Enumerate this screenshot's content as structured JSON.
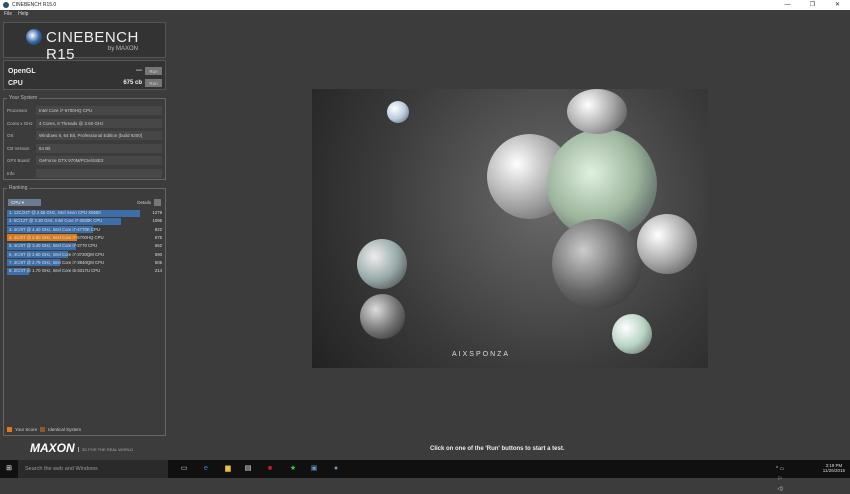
{
  "window": {
    "title": "CINEBENCH R15.0",
    "controls": [
      "—",
      "❐",
      "✕"
    ]
  },
  "menu": [
    "File",
    "Help"
  ],
  "logo": {
    "name": "CINEBENCH R15",
    "by": "by MAXON"
  },
  "scores": [
    {
      "label": "OpenGL",
      "value": "---",
      "run": "Run"
    },
    {
      "label": "CPU",
      "value": "675 cb",
      "run": "Run"
    }
  ],
  "system": {
    "title": "Your System",
    "fields": [
      {
        "label": "Processor",
        "value": "Intel Core i7-6700HQ CPU"
      },
      {
        "label": "Cores x GHz",
        "value": "4 Cores, 8 Threads @ 2.60 GHz"
      },
      {
        "label": "OS",
        "value": "Windows 8, 64 Bit, Professional Edition (build 9200)"
      },
      {
        "label": "CB Version",
        "value": "64 Bit"
      },
      {
        "label": "GFX Board",
        "value": "GeForce GTX 970M/PCIe/SSE2"
      },
      {
        "label": "Info",
        "value": ""
      }
    ]
  },
  "ranking": {
    "title": "Ranking",
    "dropdown": "CPU",
    "details": "Details",
    "max": 1279,
    "items": [
      {
        "text": "1. 12C/24T @ 2.66 GHz, Intel Xeon CPU X5650",
        "score": 1279,
        "mine": false
      },
      {
        "text": "2. 6C/12T @ 3.30 GHz,  Intel Core i7-3930K CPU",
        "score": 1096,
        "mine": false
      },
      {
        "text": "3. 4C/8T @ 4.40 GHz, Intel Core i7-4770K CPU",
        "score": 822,
        "mine": false
      },
      {
        "text": "4. 4C/8T @ 2.60 GHz, Intel Core i7-6700HQ CPU",
        "score": 675,
        "mine": true
      },
      {
        "text": "5. 4C/8T @ 3.40 GHz,  Intel Core i7-3770 CPU",
        "score": 662,
        "mine": false
      },
      {
        "text": "6. 4C/8T @ 2.60 GHz, Intel Core i7-3720QM CPU",
        "score": 590,
        "mine": false
      },
      {
        "text": "7. 4C/8T @ 2.79 GHz,  Intel Core i7-3840QM CPU",
        "score": 505,
        "mine": false
      },
      {
        "text": "8. 2C/4T @ 1.70 GHz,  Intel Core i5-3317U CPU",
        "score": 214,
        "mine": false
      }
    ],
    "legend": [
      {
        "label": "Your Score",
        "color": "#d87a1e"
      },
      {
        "label": "Identical System",
        "color": "#8a5a2a"
      }
    ]
  },
  "render": {
    "brand": "AIXSPONZA"
  },
  "footer": {
    "brand": "MAXON",
    "tagline": "3D FOR THE REAL WORLD",
    "status": "Click on one of the 'Run' buttons to start a test."
  },
  "taskbar": {
    "search": "Search the web and Windows",
    "time": "3:19 PM",
    "date": "11/26/2015"
  },
  "colors": {
    "bar": "#3d6ea8",
    "mine": "#d87a1e"
  }
}
